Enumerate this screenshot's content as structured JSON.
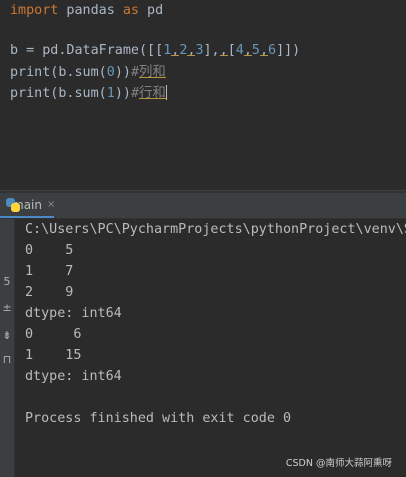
{
  "editor": {
    "line1": {
      "kw1": "import",
      "mod": " pandas ",
      "kw2": "as",
      "alias": " pd"
    },
    "line2": {
      "prefix": "b = pd.DataFrame([[",
      "n1": "1",
      "c1": ",",
      "n2": "2",
      "c2": ",",
      "n3": "3",
      "mid": "],",
      "c3": ",",
      "open": "[",
      "n4": "4",
      "c4": ",",
      "n5": "5",
      "c5": ",",
      "n6": "6",
      "suffix": "]])"
    },
    "line3": {
      "code_a": "print(b.sum(",
      "arg": "0",
      "code_b": "))",
      "comment_hash": "#",
      "comment_text": "列和"
    },
    "line4": {
      "code_a": "print(b.sum(",
      "arg": "1",
      "code_b": "))",
      "comment_hash": "#",
      "comment_text": "行和"
    }
  },
  "run_panel": {
    "tab_label": "main",
    "tab_close": "×",
    "side_glyphs": [
      "5",
      "±",
      "⇟",
      "⊓"
    ]
  },
  "console": {
    "lines": [
      "C:\\Users\\PC\\PycharmProjects\\pythonProject\\venv\\S",
      "0    5",
      "1    7",
      "2    9",
      "dtype: int64",
      "0     6",
      "1    15",
      "dtype: int64",
      "",
      "Process finished with exit code 0"
    ]
  },
  "watermark": "CSDN @南师大蒜阿熏呀",
  "colors": {
    "keyword": "#cc7832",
    "number": "#6897bb",
    "comment": "#808080",
    "text": "#a9b7c6",
    "tab_accent": "#4a88c7"
  }
}
